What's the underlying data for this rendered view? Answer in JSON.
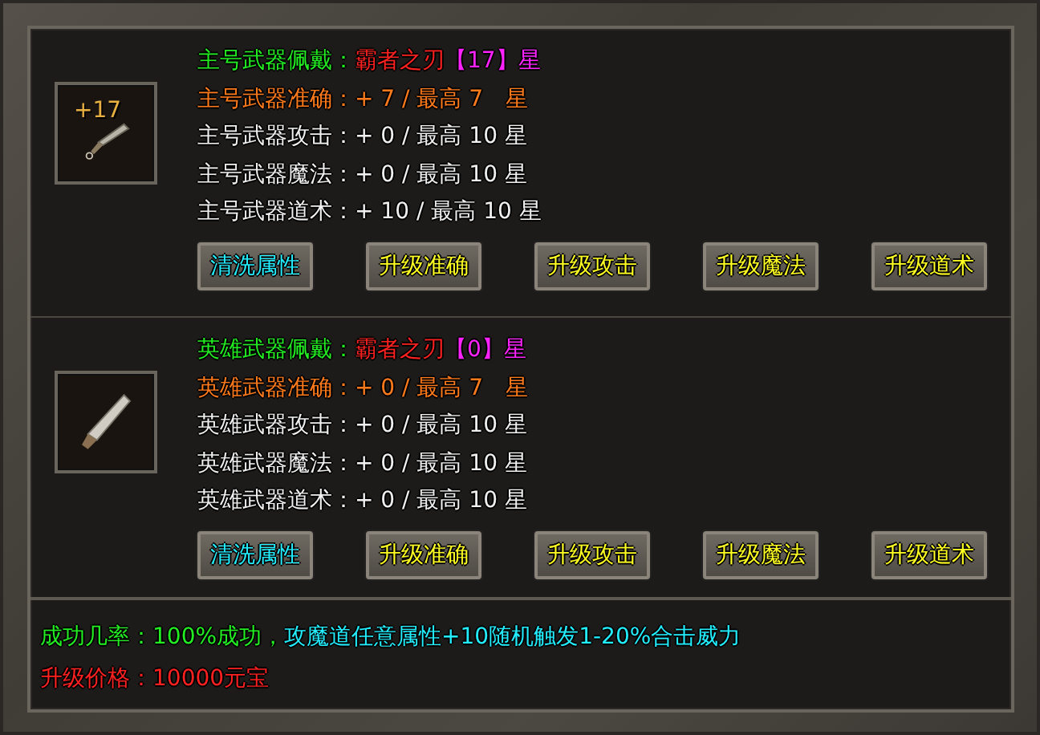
{
  "sections": [
    {
      "badge": "+17",
      "lines": [
        [
          {
            "text": "主号武器佩戴：",
            "color": "#22ee22"
          },
          {
            "text": "霸者之刃",
            "color": "#ff2020"
          },
          {
            "text": "【17】星",
            "color": "#ff22ff"
          }
        ],
        [
          {
            "text": "主号武器准确：",
            "color": "#ff7a1a"
          },
          {
            "text": "+ 7 / 最高 7　星",
            "color": "#ff7a1a"
          }
        ],
        [
          {
            "text": "主号武器攻击：",
            "color": "#f0f0f0"
          },
          {
            "text": "+ 0 / 最高 10 星",
            "color": "#f0f0f0"
          }
        ],
        [
          {
            "text": "主号武器魔法：",
            "color": "#f0f0f0"
          },
          {
            "text": "+ 0 / 最高 10 星",
            "color": "#f0f0f0"
          }
        ],
        [
          {
            "text": "主号武器道术：",
            "color": "#f0f0f0"
          },
          {
            "text": "+ 10 / 最高 10 星",
            "color": "#f0f0f0"
          }
        ]
      ],
      "buttons": [
        {
          "label": "清洗属性",
          "kind": "reset"
        },
        {
          "label": "升级准确",
          "kind": "upgrade"
        },
        {
          "label": "升级攻击",
          "kind": "upgrade"
        },
        {
          "label": "升级魔法",
          "kind": "upgrade"
        },
        {
          "label": "升级道术",
          "kind": "upgrade"
        }
      ]
    },
    {
      "lines": [
        [
          {
            "text": "英雄武器佩戴：",
            "color": "#22ee22"
          },
          {
            "text": "霸者之刃",
            "color": "#ff2020"
          },
          {
            "text": "【0】星",
            "color": "#ff22ff"
          }
        ],
        [
          {
            "text": "英雄武器准确：",
            "color": "#ff7a1a"
          },
          {
            "text": "+ 0 / 最高 7　星",
            "color": "#ff7a1a"
          }
        ],
        [
          {
            "text": "英雄武器攻击：",
            "color": "#f0f0f0"
          },
          {
            "text": "+ 0 / 最高 10 星",
            "color": "#f0f0f0"
          }
        ],
        [
          {
            "text": "英雄武器魔法：",
            "color": "#f0f0f0"
          },
          {
            "text": "+ 0 / 最高 10 星",
            "color": "#f0f0f0"
          }
        ],
        [
          {
            "text": "英雄武器道术：",
            "color": "#f0f0f0"
          },
          {
            "text": "+ 0 / 最高 10 星",
            "color": "#f0f0f0"
          }
        ]
      ],
      "buttons": [
        {
          "label": "清洗属性",
          "kind": "reset"
        },
        {
          "label": "升级准确",
          "kind": "upgrade"
        },
        {
          "label": "升级攻击",
          "kind": "upgrade"
        },
        {
          "label": "升级魔法",
          "kind": "upgrade"
        },
        {
          "label": "升级道术",
          "kind": "upgrade"
        }
      ]
    }
  ],
  "footer": [
    [
      {
        "text": "成功几率：",
        "color": "#22ee22"
      },
      {
        "text": "100%成功，",
        "color": "#22ee22"
      },
      {
        "text": "攻魔道任意属性+10随机触发1-20%合击威力",
        "color": "#22eeff"
      }
    ],
    [
      {
        "text": "升级价格：",
        "color": "#ff2020"
      },
      {
        "text": "10000元宝",
        "color": "#ff2020"
      }
    ]
  ]
}
